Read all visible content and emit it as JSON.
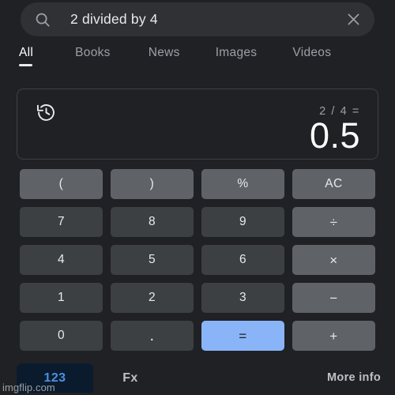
{
  "search": {
    "query": "2 divided by 4",
    "placeholder": "Search",
    "search_icon": "search-icon",
    "clear_icon": "close-icon"
  },
  "tabs": [
    {
      "label": "All",
      "active": true
    },
    {
      "label": "Books",
      "active": false
    },
    {
      "label": "News",
      "active": false
    },
    {
      "label": "Images",
      "active": false
    },
    {
      "label": "Videos",
      "active": false
    }
  ],
  "calculator": {
    "history_icon": "history-icon",
    "expression": "2 / 4 =",
    "result": "0.5",
    "keys": [
      {
        "label": "(",
        "type": "fn"
      },
      {
        "label": ")",
        "type": "fn"
      },
      {
        "label": "%",
        "type": "fn"
      },
      {
        "label": "AC",
        "type": "fn"
      },
      {
        "label": "7",
        "type": "num"
      },
      {
        "label": "8",
        "type": "num"
      },
      {
        "label": "9",
        "type": "num"
      },
      {
        "label": "÷",
        "type": "op"
      },
      {
        "label": "4",
        "type": "num"
      },
      {
        "label": "5",
        "type": "num"
      },
      {
        "label": "6",
        "type": "num"
      },
      {
        "label": "×",
        "type": "op"
      },
      {
        "label": "1",
        "type": "num"
      },
      {
        "label": "2",
        "type": "num"
      },
      {
        "label": "3",
        "type": "num"
      },
      {
        "label": "−",
        "type": "op"
      },
      {
        "label": "0",
        "type": "num"
      },
      {
        "label": ".",
        "type": "dot"
      },
      {
        "label": "=",
        "type": "eq"
      },
      {
        "label": "+",
        "type": "op"
      }
    ]
  },
  "footer": {
    "numeric_tab": "123",
    "function_tab": "Fx",
    "more_info": "More info",
    "watermark": "imgflip.com"
  },
  "colors": {
    "background": "#202124",
    "searchbar": "#303134",
    "card_border": "#3c4043",
    "key_function": "#5f6368",
    "key_number": "#3c4043",
    "accent_blue": "#8ab4f8",
    "tab_active_blue": "#4a90e2",
    "text_primary": "#e8eaed",
    "text_secondary": "#9aa0a6"
  }
}
